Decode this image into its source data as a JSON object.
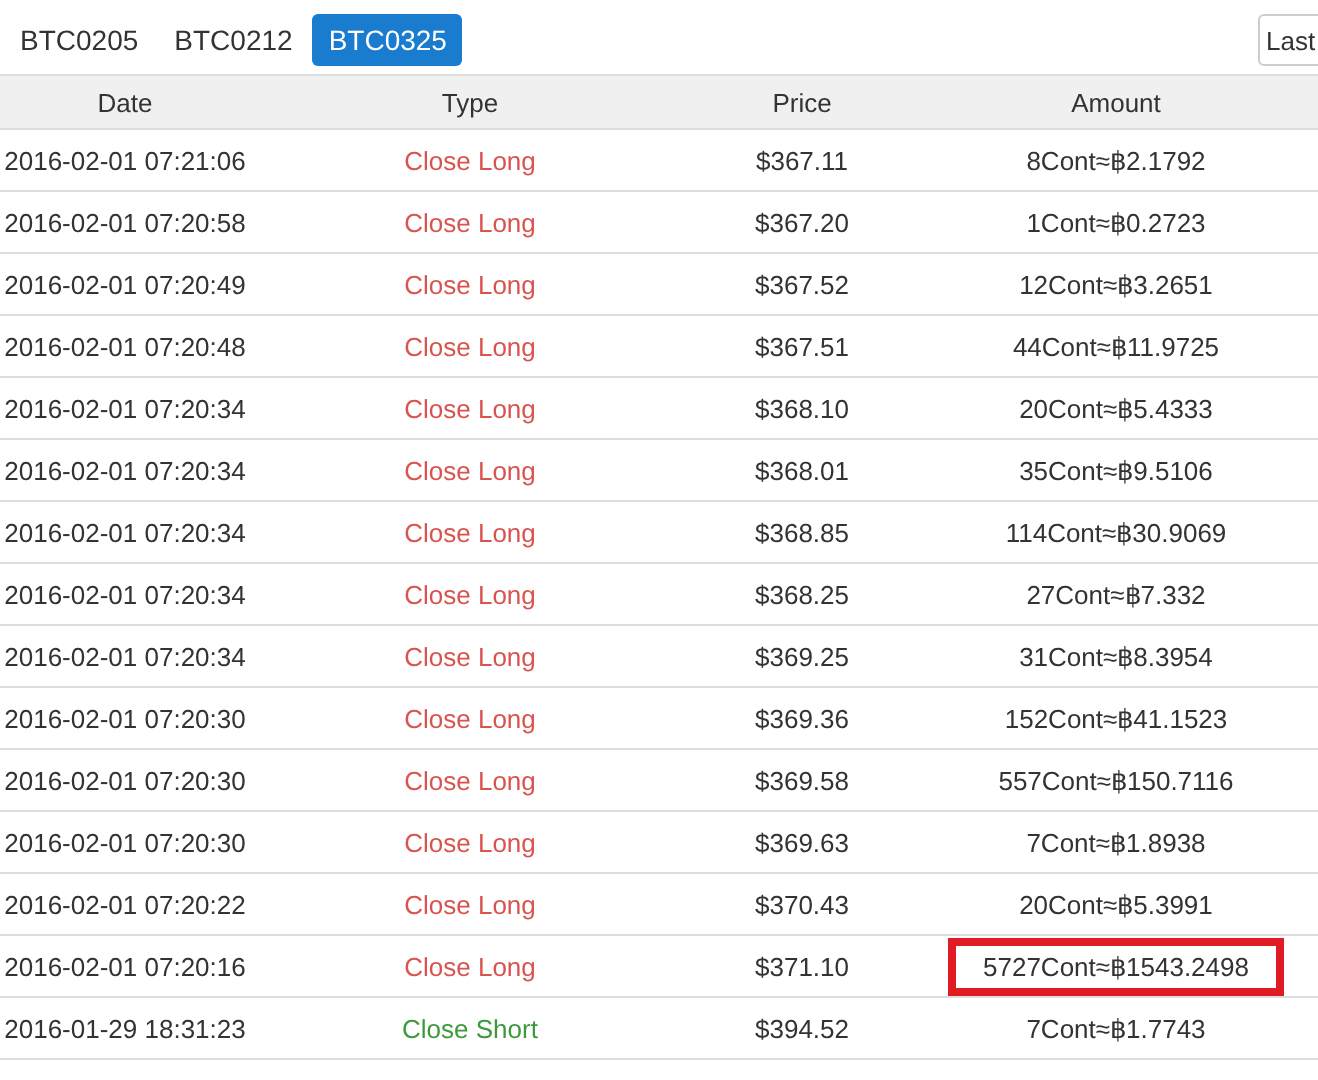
{
  "tabs": [
    {
      "label": "BTC0205",
      "selected": false
    },
    {
      "label": "BTC0212",
      "selected": false
    },
    {
      "label": "BTC0325",
      "selected": true
    }
  ],
  "select": {
    "value": "Last"
  },
  "table": {
    "columns": [
      "Date",
      "Type",
      "Price",
      "Amount"
    ],
    "rows": [
      {
        "date": "2016-02-01 07:21:06",
        "type": "Close Long",
        "kind": "long",
        "price": "$367.11",
        "amount": "8Cont≈฿2.1792",
        "highlighted": false
      },
      {
        "date": "2016-02-01 07:20:58",
        "type": "Close Long",
        "kind": "long",
        "price": "$367.20",
        "amount": "1Cont≈฿0.2723",
        "highlighted": false
      },
      {
        "date": "2016-02-01 07:20:49",
        "type": "Close Long",
        "kind": "long",
        "price": "$367.52",
        "amount": "12Cont≈฿3.2651",
        "highlighted": false
      },
      {
        "date": "2016-02-01 07:20:48",
        "type": "Close Long",
        "kind": "long",
        "price": "$367.51",
        "amount": "44Cont≈฿11.9725",
        "highlighted": false
      },
      {
        "date": "2016-02-01 07:20:34",
        "type": "Close Long",
        "kind": "long",
        "price": "$368.10",
        "amount": "20Cont≈฿5.4333",
        "highlighted": false
      },
      {
        "date": "2016-02-01 07:20:34",
        "type": "Close Long",
        "kind": "long",
        "price": "$368.01",
        "amount": "35Cont≈฿9.5106",
        "highlighted": false
      },
      {
        "date": "2016-02-01 07:20:34",
        "type": "Close Long",
        "kind": "long",
        "price": "$368.85",
        "amount": "114Cont≈฿30.9069",
        "highlighted": false
      },
      {
        "date": "2016-02-01 07:20:34",
        "type": "Close Long",
        "kind": "long",
        "price": "$368.25",
        "amount": "27Cont≈฿7.332",
        "highlighted": false
      },
      {
        "date": "2016-02-01 07:20:34",
        "type": "Close Long",
        "kind": "long",
        "price": "$369.25",
        "amount": "31Cont≈฿8.3954",
        "highlighted": false
      },
      {
        "date": "2016-02-01 07:20:30",
        "type": "Close Long",
        "kind": "long",
        "price": "$369.36",
        "amount": "152Cont≈฿41.1523",
        "highlighted": false
      },
      {
        "date": "2016-02-01 07:20:30",
        "type": "Close Long",
        "kind": "long",
        "price": "$369.58",
        "amount": "557Cont≈฿150.7116",
        "highlighted": false
      },
      {
        "date": "2016-02-01 07:20:30",
        "type": "Close Long",
        "kind": "long",
        "price": "$369.63",
        "amount": "7Cont≈฿1.8938",
        "highlighted": false
      },
      {
        "date": "2016-02-01 07:20:22",
        "type": "Close Long",
        "kind": "long",
        "price": "$370.43",
        "amount": "20Cont≈฿5.3991",
        "highlighted": false
      },
      {
        "date": "2016-02-01 07:20:16",
        "type": "Close Long",
        "kind": "long",
        "price": "$371.10",
        "amount": "5727Cont≈฿1543.2498",
        "highlighted": true
      },
      {
        "date": "2016-01-29 18:31:23",
        "type": "Close Short",
        "kind": "short",
        "price": "$394.52",
        "amount": "7Cont≈฿1.7743",
        "highlighted": false
      }
    ]
  }
}
